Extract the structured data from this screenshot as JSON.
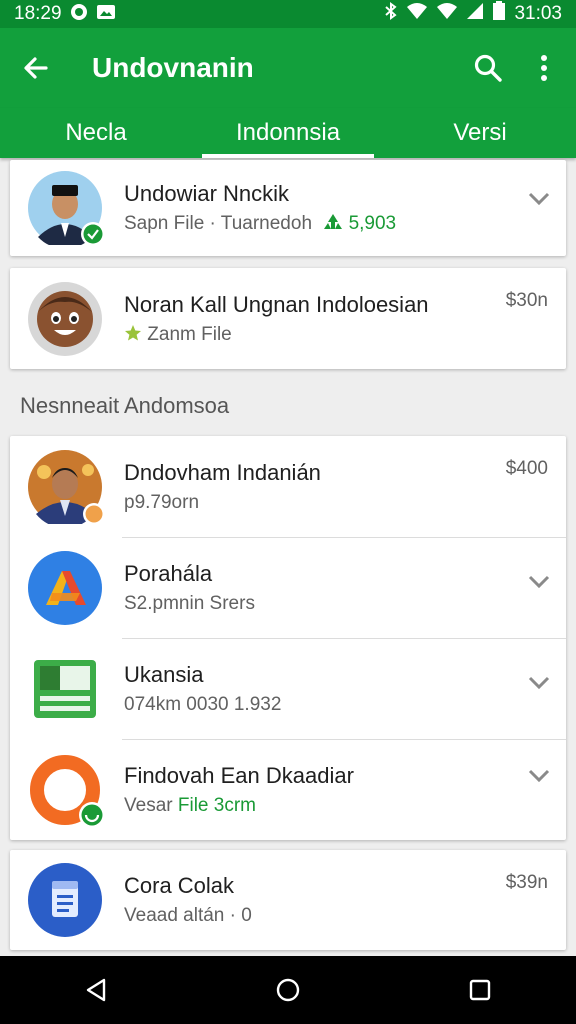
{
  "status_bar": {
    "time": "18:29",
    "clock_right": "31:03"
  },
  "app_bar": {
    "title": "Undovnanin"
  },
  "tabs": [
    {
      "label": "Necla"
    },
    {
      "label": "Indonnsia"
    },
    {
      "label": "Versi"
    }
  ],
  "top_items": [
    {
      "name": "Undowiar Nnckik",
      "sub_prefix": "Sapn File · Tuarnedoh",
      "sub_count": "5,903"
    },
    {
      "name": "Noran Kall Ungnan Indoloesian",
      "sub": "Zanm File",
      "price": "$30n"
    }
  ],
  "section": {
    "title": "Nesnneait Andomsoa"
  },
  "list_items": [
    {
      "name": "Dndovham Indanián",
      "sub": "p9.79orn",
      "price": "$400"
    },
    {
      "name": "Porahála",
      "sub": "S2.pmnin Srers"
    },
    {
      "name": "Ukansia",
      "sub": "074km 0030 1.932"
    },
    {
      "name": "Findovah Ean Dkaadiar",
      "sub_prefix": "Vesar",
      "sub_highlight": "File 3crm"
    }
  ],
  "bottom_item": {
    "name": "Cora Colak",
    "sub": "Veaad altán · 0",
    "price": "$39n"
  },
  "colors": {
    "primary": "#12a03c",
    "status_bar": "#0a8a30",
    "accent_green": "#1a9a36"
  }
}
